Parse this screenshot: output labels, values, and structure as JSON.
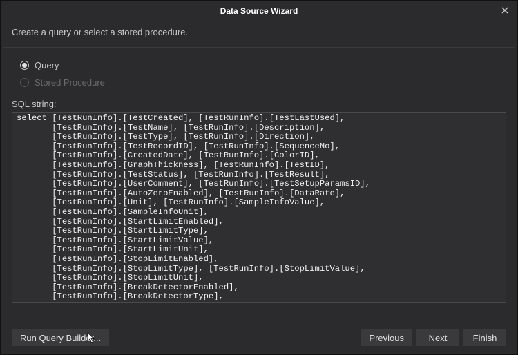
{
  "title": "Data Source Wizard",
  "intro": "Create a query or select a stored procedure.",
  "options": {
    "query_label": "Query",
    "stored_proc_label": "Stored Procedure"
  },
  "sql_label": "SQL string:",
  "sql_text": "select [TestRunInfo].[TestCreated], [TestRunInfo].[TestLastUsed],\n       [TestRunInfo].[TestName], [TestRunInfo].[Description],\n       [TestRunInfo].[TestType], [TestRunInfo].[Direction],\n       [TestRunInfo].[TestRecordID], [TestRunInfo].[SequenceNo],\n       [TestRunInfo].[CreatedDate], [TestRunInfo].[ColorID],\n       [TestRunInfo].[GraphThickness], [TestRunInfo].[TestID],\n       [TestRunInfo].[TestStatus], [TestRunInfo].[TestResult],\n       [TestRunInfo].[UserComment], [TestRunInfo].[TestSetupParamsID],\n       [TestRunInfo].[AutoZeroEnabled], [TestRunInfo].[DataRate],\n       [TestRunInfo].[Unit], [TestRunInfo].[SampleInfoValue],\n       [TestRunInfo].[SampleInfoUnit],\n       [TestRunInfo].[StartLimitEnabled],\n       [TestRunInfo].[StartLimitType],\n       [TestRunInfo].[StartLimitValue],\n       [TestRunInfo].[StartLimitUnit],\n       [TestRunInfo].[StopLimitEnabled],\n       [TestRunInfo].[StopLimitType], [TestRunInfo].[StopLimitValue],\n       [TestRunInfo].[StopLimitUnit],\n       [TestRunInfo].[BreakDetectorEnabled],\n       [TestRunInfo].[BreakDetectorType],\n       [TestRunInfo].[ActivationForce],",
  "buttons": {
    "run_query_builder": "Run Query Builder...",
    "previous": "Previous",
    "next": "Next",
    "finish": "Finish"
  }
}
